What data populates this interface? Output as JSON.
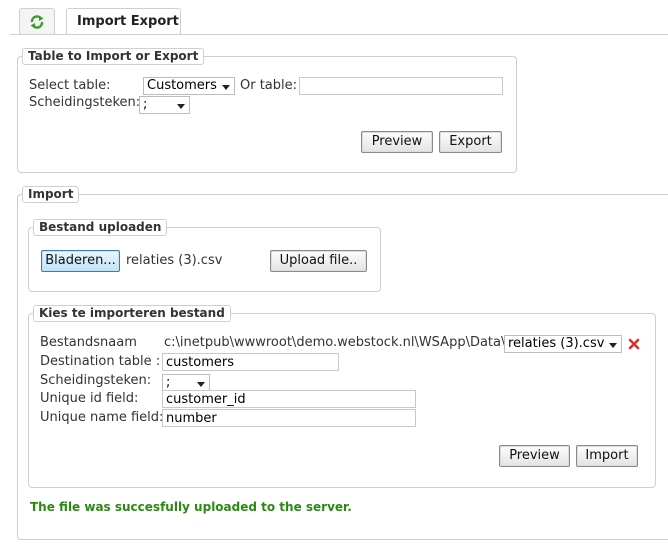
{
  "tabs": {
    "refresh_icon": "refresh-icon",
    "import_export_label": "Import  Export"
  },
  "table_section": {
    "legend": "Table to Import or Export",
    "select_table_label": "Select table:",
    "selected_table": "Customers",
    "or_table_label": "Or table:",
    "or_table_value": "",
    "separator_label": "Scheidingsteken:",
    "separator_value": ";",
    "preview_label": "Preview",
    "export_label": "Export"
  },
  "import_section": {
    "legend": "Import",
    "upload": {
      "legend": "Bestand uploaden",
      "browse_label": "Bladeren...",
      "file_name": "relaties (3).csv",
      "upload_label": "Upload file.."
    },
    "choose": {
      "legend": "Kies te importeren bestand",
      "filename_label": "Bestandsnaam",
      "path": "c:\\inetpub\\wwwroot\\demo.webstock.nl\\WSApp\\Data\\",
      "selected_file": "relaties (3).csv",
      "destination_label": "Destination table :",
      "destination_value": "customers",
      "separator_label": "Scheidingsteken:",
      "separator_value": ";",
      "unique_id_label": "Unique id field:",
      "unique_id_value": "customer_id",
      "unique_name_label": "Unique name field:",
      "unique_name_value": "number",
      "preview_label": "Preview",
      "import_label": "Import"
    },
    "status": "The file was succesfully uploaded to the server."
  },
  "colors": {
    "success": "#2a8a14",
    "delete": "#d9342b",
    "refresh": "#3a9a2a"
  }
}
